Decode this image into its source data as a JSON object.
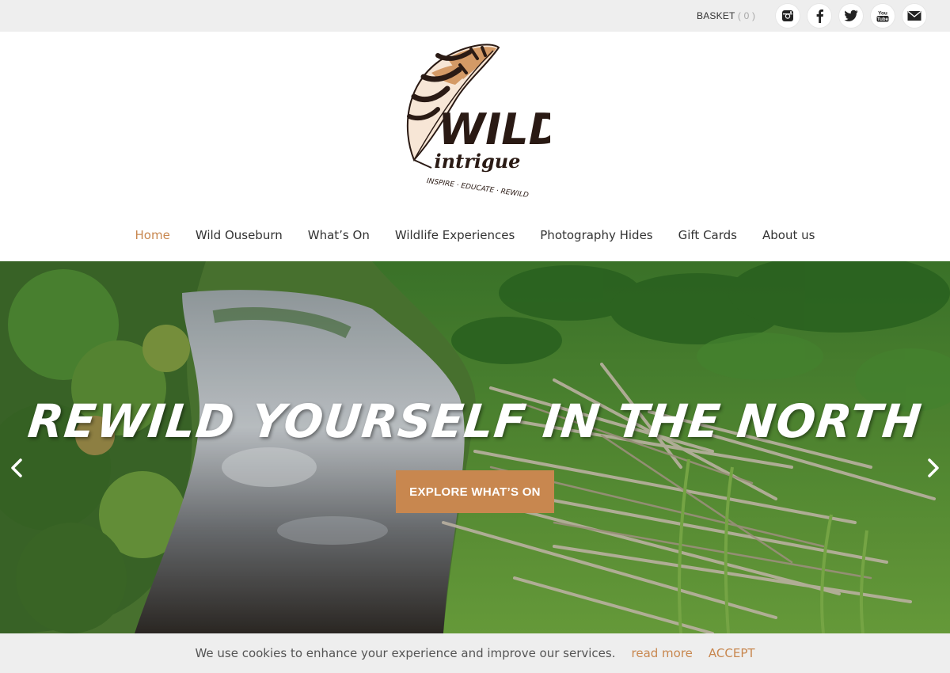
{
  "topbar": {
    "basket_label": "BASKET",
    "basket_count": "( 0 )",
    "social_icons": [
      "instagram-icon",
      "facebook-icon",
      "twitter-icon",
      "youtube-icon",
      "email-icon"
    ],
    "youtube_text": "You\nTube"
  },
  "logo": {
    "wordmark_1": "WILD",
    "wordmark_2": "intrigue",
    "tagline": "INSPIRE · EDUCATE · REWILD"
  },
  "nav": {
    "items": [
      {
        "label": "Home",
        "active": true
      },
      {
        "label": "Wild Ouseburn",
        "active": false
      },
      {
        "label": "What’s On",
        "active": false
      },
      {
        "label": "Wildlife Experiences",
        "active": false
      },
      {
        "label": "Photography Hides",
        "active": false
      },
      {
        "label": "Gift Cards",
        "active": false
      },
      {
        "label": "About us",
        "active": false
      }
    ]
  },
  "hero": {
    "title": "REWILD YOURSELF IN THE NORTH",
    "cta_label": "EXPLORE WHAT’S ON"
  },
  "cookie": {
    "message": "We use cookies to enhance your experience and improve our services.",
    "read_more": "read more",
    "accept": "ACCEPT"
  },
  "colors": {
    "accent": "#c8874f",
    "topbar_bg": "#eeeeee",
    "text": "#333333"
  }
}
